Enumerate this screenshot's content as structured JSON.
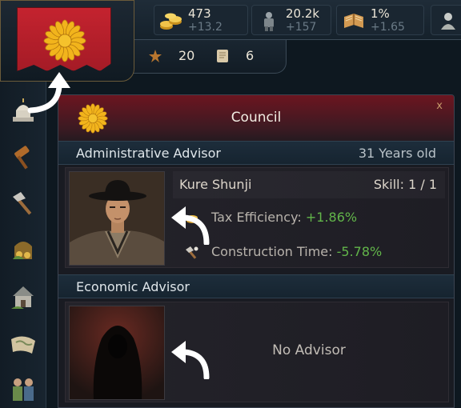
{
  "resources": [
    {
      "icon": "gold-coins-icon",
      "value": "473",
      "change": "+13.2"
    },
    {
      "icon": "manpower-soldier-icon",
      "value": "20.2k",
      "change": "+157"
    },
    {
      "icon": "book-research-icon",
      "value": "1%",
      "change": "+1.65"
    }
  ],
  "subbar": [
    {
      "icon": "star-icon",
      "value": "20"
    },
    {
      "icon": "scroll-icon",
      "value": "6"
    }
  ],
  "sidebar_icons": [
    "capitol-icon",
    "gavel-icon",
    "hammer-icon",
    "treasure-icon",
    "building-icon",
    "map-icon",
    "advisors-icon"
  ],
  "panel": {
    "title": "Council",
    "close": "x"
  },
  "administrative": {
    "label": "Administrative Advisor",
    "age": "31 Years old",
    "name": "Kure Shunji",
    "skill": "Skill: 1 / 1",
    "stats": [
      {
        "icon": "coins-icon",
        "label": "Tax Efficiency:",
        "value": "+1.86%"
      },
      {
        "icon": "hammer-icon",
        "label": "Construction Time:",
        "value": "-5.78%"
      }
    ]
  },
  "economic": {
    "label": "Economic Advisor",
    "empty_text": "No Advisor"
  },
  "colors": {
    "accent_red": "#a51b26",
    "positive_green": "#62b54a",
    "chrysanthemum": "#f2b41c"
  }
}
